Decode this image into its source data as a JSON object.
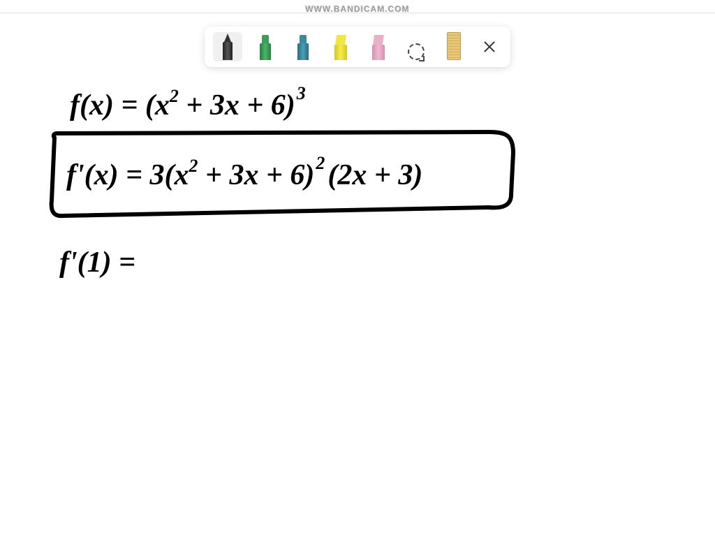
{
  "watermark": "WWW.BANDICAM.COM",
  "toolbar": {
    "tools": [
      {
        "name": "pen-black",
        "selected": true
      },
      {
        "name": "marker-green",
        "selected": false
      },
      {
        "name": "marker-teal",
        "selected": false
      },
      {
        "name": "highlighter-yellow",
        "selected": false
      },
      {
        "name": "highlighter-pink",
        "selected": false
      },
      {
        "name": "lasso-select",
        "selected": false
      },
      {
        "name": "ruler",
        "selected": false
      }
    ]
  },
  "handwritten": {
    "line1": {
      "prefix": "f(x) = (x",
      "exp1": "2",
      "mid": " + 3x + 6)",
      "exp2": "3"
    },
    "line2": {
      "prefix": "f'(x) = 3(x",
      "exp1": "2",
      "mid": " + 3x + 6)",
      "exp2": "2",
      "suffix": "(2x + 3)"
    },
    "line3": "f'(1)  ="
  }
}
